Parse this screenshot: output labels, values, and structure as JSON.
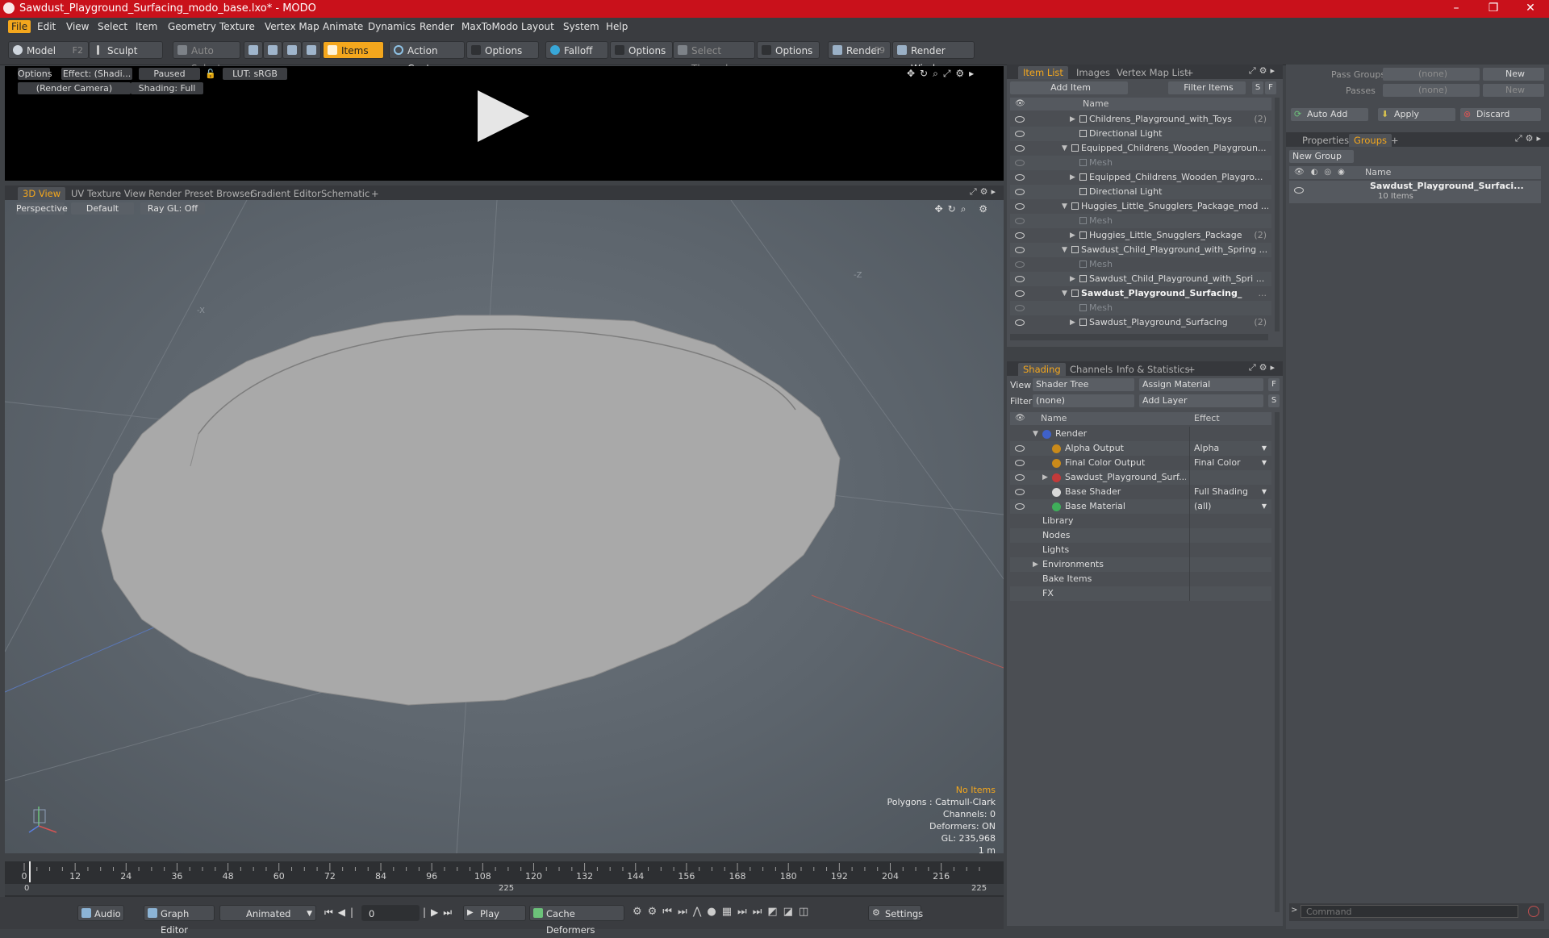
{
  "window": {
    "title": "Sawdust_Playground_Surfacing_modo_base.lxo* - MODO",
    "min_icon": "minimize-icon",
    "max_icon": "restore-icon",
    "close_icon": "close-icon"
  },
  "menu": [
    "File",
    "Edit",
    "View",
    "Select",
    "Item",
    "Geometry",
    "Texture",
    "Vertex Map",
    "Animate",
    "Dynamics",
    "Render",
    "MaxToModo",
    "Layout",
    "System",
    "Help"
  ],
  "toolbar": {
    "model": "Model",
    "model_key": "F2",
    "sculpt": "Sculpt",
    "auto_select": "Auto Select",
    "items": "Items",
    "action_center": "Action Center",
    "options1": "Options",
    "falloff": "Falloff",
    "options2": "Options",
    "select_through": "Select Through",
    "options3": "Options",
    "render": "Render",
    "render_key": "F9",
    "render_window": "Render Window"
  },
  "preview": {
    "options": "Options",
    "effect": "Effect: (Shadi...",
    "paused": "Paused",
    "lut": "LUT: sRGB",
    "camera": "(Render Camera)",
    "shading": "Shading: Full"
  },
  "viewport_tabs": [
    "3D View",
    "UV Texture View",
    "Render Preset Browser",
    "Gradient Editor",
    "Schematic",
    "+"
  ],
  "viewport": {
    "perspective": "Perspective",
    "default": "Default",
    "raygl": "Ray GL: Off",
    "axis_y": "-X",
    "axis_z": "-Z",
    "info": [
      "No Items",
      "Polygons : Catmull-Clark",
      "Channels: 0",
      "Deformers: ON",
      "GL: 235,968",
      "1 m"
    ]
  },
  "timeline": {
    "ticks": [
      "0",
      "12",
      "24",
      "36",
      "48",
      "60",
      "72",
      "84",
      "96",
      "108",
      "120",
      "132",
      "144",
      "156",
      "168",
      "180",
      "192",
      "204",
      "216"
    ],
    "lower": [
      "0",
      "225",
      "225"
    ]
  },
  "bottombar": {
    "audio": "Audio",
    "graph_editor": "Graph Editor",
    "animated": "Animated",
    "frame": "0",
    "play": "Play",
    "cache": "Cache Deformers",
    "settings": "Settings"
  },
  "item_list": {
    "tabs": [
      "Item List",
      "Images",
      "Vertex Map List",
      "+"
    ],
    "add_item": "Add Item",
    "filter": "Filter Items",
    "s": "S",
    "f": "F",
    "name_header": "Name",
    "rows": [
      {
        "name": "Childrens_Playground_with_Toys",
        "count": "(2)",
        "indent": 2,
        "arrow": "▶",
        "dim": false,
        "bold": false
      },
      {
        "name": "Directional Light",
        "count": "",
        "indent": 2,
        "arrow": "",
        "dim": false,
        "bold": false
      },
      {
        "name": "Equipped_Childrens_Wooden_Playgroun...",
        "count": "",
        "indent": 1,
        "arrow": "▼",
        "dim": false,
        "bold": false
      },
      {
        "name": "Mesh",
        "count": "",
        "indent": 2,
        "arrow": "",
        "dim": true,
        "bold": false
      },
      {
        "name": "Equipped_Childrens_Wooden_Playgro...",
        "count": "",
        "indent": 2,
        "arrow": "▶",
        "dim": false,
        "bold": false
      },
      {
        "name": "Directional Light",
        "count": "",
        "indent": 2,
        "arrow": "",
        "dim": false,
        "bold": false
      },
      {
        "name": "Huggies_Little_Snugglers_Package_mod ...",
        "count": "",
        "indent": 1,
        "arrow": "▼",
        "dim": false,
        "bold": false
      },
      {
        "name": "Mesh",
        "count": "",
        "indent": 2,
        "arrow": "",
        "dim": true,
        "bold": false
      },
      {
        "name": "Huggies_Little_Snugglers_Package",
        "count": "(2)",
        "indent": 2,
        "arrow": "▶",
        "dim": false,
        "bold": false
      },
      {
        "name": "Sawdust_Child_Playground_with_Spring ...",
        "count": "",
        "indent": 1,
        "arrow": "▼",
        "dim": false,
        "bold": false
      },
      {
        "name": "Mesh",
        "count": "",
        "indent": 2,
        "arrow": "",
        "dim": true,
        "bold": false
      },
      {
        "name": "Sawdust_Child_Playground_with_Spri ...",
        "count": "",
        "indent": 2,
        "arrow": "▶",
        "dim": false,
        "bold": false
      },
      {
        "name": "Sawdust_Playground_Surfacing_",
        "count": "...",
        "indent": 1,
        "arrow": "▼",
        "dim": false,
        "bold": true
      },
      {
        "name": "Mesh",
        "count": "",
        "indent": 2,
        "arrow": "",
        "dim": true,
        "bold": false
      },
      {
        "name": "Sawdust_Playground_Surfacing",
        "count": "(2)",
        "indent": 2,
        "arrow": "▶",
        "dim": false,
        "bold": false
      }
    ]
  },
  "shading": {
    "tabs": [
      "Shading",
      "Channels",
      "Info & Statistics",
      "+"
    ],
    "view_label": "View",
    "view_value": "Shader Tree",
    "assign_material": "Assign Material",
    "filter_label": "Filter",
    "filter_value": "(none)",
    "add_layer": "Add Layer",
    "f": "F",
    "s": "S",
    "name_header": "Name",
    "effect_header": "Effect",
    "rows": [
      {
        "name": "Render",
        "effect": "",
        "indent": 0,
        "arrow": "▼",
        "eye": false,
        "color": "#3f61c9"
      },
      {
        "name": "Alpha Output",
        "effect": "Alpha",
        "indent": 1,
        "arrow": "",
        "eye": true,
        "color": "#c98a1a"
      },
      {
        "name": "Final Color Output",
        "effect": "Final Color",
        "indent": 1,
        "arrow": "",
        "eye": true,
        "color": "#c98a1a"
      },
      {
        "name": "Sawdust_Playground_Surf...",
        "effect": "",
        "indent": 1,
        "arrow": "▶",
        "eye": true,
        "color": "#c23a3a"
      },
      {
        "name": "Base Shader",
        "effect": "Full Shading",
        "indent": 1,
        "arrow": "",
        "eye": true,
        "color": "#d8d8d8"
      },
      {
        "name": "Base Material",
        "effect": "(all)",
        "indent": 1,
        "arrow": "",
        "eye": true,
        "color": "#3fae5a"
      },
      {
        "name": "Library",
        "effect": "",
        "indent": 0,
        "arrow": "",
        "eye": false,
        "color": ""
      },
      {
        "name": "Nodes",
        "effect": "",
        "indent": 0,
        "arrow": "",
        "eye": false,
        "color": ""
      },
      {
        "name": "Lights",
        "effect": "",
        "indent": 0,
        "arrow": "",
        "eye": false,
        "color": ""
      },
      {
        "name": "Environments",
        "effect": "",
        "indent": 0,
        "arrow": "▶",
        "eye": false,
        "color": ""
      },
      {
        "name": "Bake Items",
        "effect": "",
        "indent": 0,
        "arrow": "",
        "eye": false,
        "color": ""
      },
      {
        "name": "FX",
        "effect": "",
        "indent": 0,
        "arrow": "",
        "eye": false,
        "color": ""
      }
    ]
  },
  "groups": {
    "pass_groups_label": "Pass Groups",
    "pass_groups_value": "(none)",
    "passes_label": "Passes",
    "passes_value": "(none)",
    "new1": "New",
    "new2": "New",
    "auto_add": "Auto Add",
    "apply": "Apply",
    "discard": "Discard",
    "tabs": [
      "Properties",
      "Groups",
      "+"
    ],
    "new_group": "New Group",
    "name_header": "Name",
    "group_name": "Sawdust_Playground_Surfaci...",
    "group_count": "10 Items",
    "command_placeholder": "Command"
  },
  "colors": {
    "titlebar": "#c9111b",
    "accent": "#f4a71d"
  }
}
